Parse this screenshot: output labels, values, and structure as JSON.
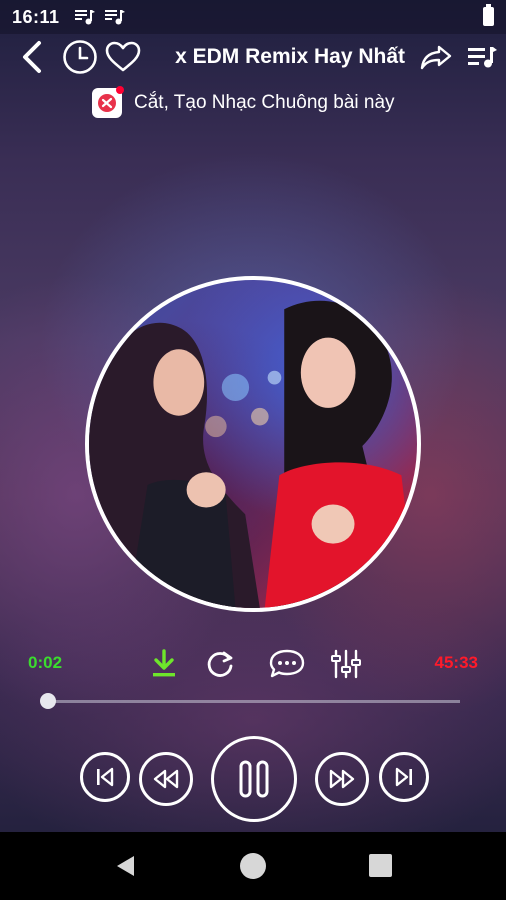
{
  "status_bar": {
    "time": "16:11",
    "icons": [
      "music-note-icon",
      "music-note-icon",
      "battery-icon"
    ]
  },
  "header": {
    "song_title": "x EDM Remix Hay Nhất",
    "icons": [
      "back-arrow-icon",
      "clock-icon",
      "heart-icon",
      "share-icon",
      "playlist-icon"
    ]
  },
  "ringtone": {
    "label": "Cắt, Tạo Nhạc Chuông bài này",
    "icon": "ringtone-scissors-icon"
  },
  "player": {
    "current_time": "0:02",
    "total_time": "45:33",
    "progress": 0.001,
    "tools": [
      "download-icon",
      "repeat-icon",
      "lyrics-chat-icon",
      "equalizer-icon"
    ],
    "controls": [
      "skip-previous-icon",
      "rewind-icon",
      "pause-icon",
      "fast-forward-icon",
      "skip-next-icon"
    ]
  },
  "colors": {
    "current_time": "#3bdc2e",
    "total_time": "#ff1a2a",
    "download": "#6ee62b"
  },
  "nav_bar": {
    "icons": [
      "nav-back-icon",
      "nav-home-icon",
      "nav-recents-icon"
    ]
  }
}
